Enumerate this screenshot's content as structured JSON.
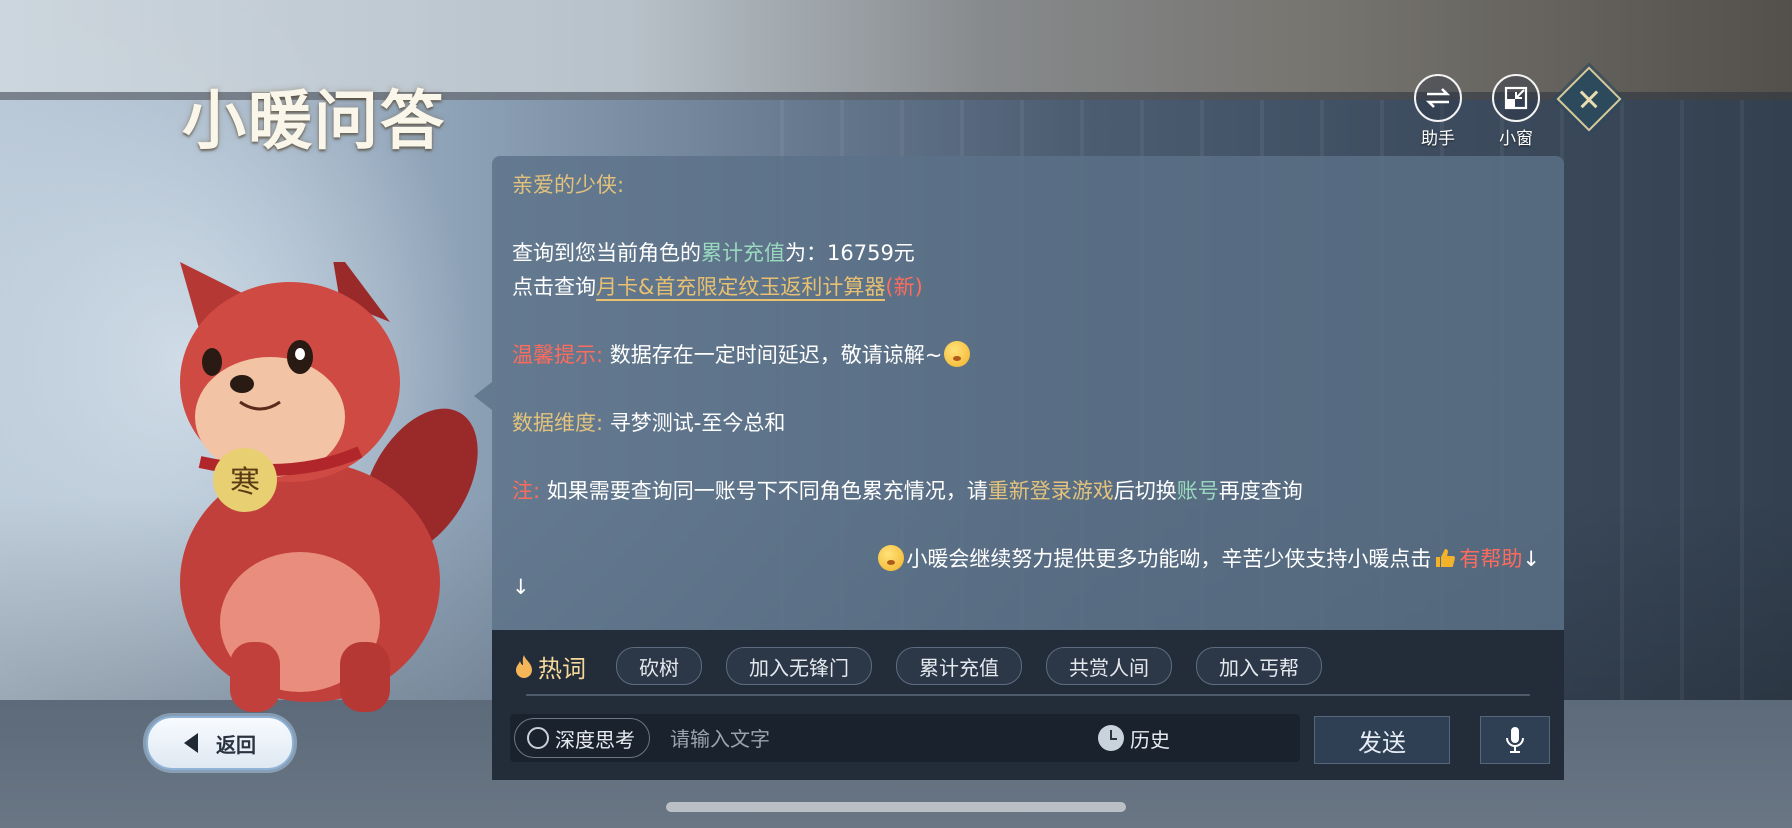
{
  "title": "小暖问答",
  "top_buttons": [
    {
      "label": "助手",
      "icon": "swap-arrows-icon"
    },
    {
      "label": "小窗",
      "icon": "minimize-window-icon"
    }
  ],
  "close_icon": "close-x-icon",
  "message": {
    "greeting": "亲爱的少侠:",
    "line1_prefix": "查询到您当前角色的",
    "line1_highlight": "累计充值",
    "line1_suffix": "为：16759元",
    "line2_prefix": "点击查询",
    "line2_link": "月卡&首充限定纹玉返利计算器",
    "line2_new": "(新)",
    "tip_label": "温馨提示:",
    "tip_text": " 数据存在一定时间延迟，敬请谅解~",
    "dim_label": "数据维度:",
    "dim_text": " 寻梦测试-至今总和",
    "note_label": "注:",
    "note_text1": " 如果需要查询同一账号下不同角色累充情况，请",
    "note_hl1": "重新登录游戏",
    "note_text2": "后切换",
    "note_hl2": "账号",
    "note_text3": "再度查询",
    "footer_text": "小暖会继续努力提供更多功能呦，辛苦少侠支持小暖点击",
    "footer_helpful": "有帮助",
    "footer_arrow": "↓",
    "trailing_arrow": "↓"
  },
  "hot": {
    "label": "热词",
    "chips": [
      "砍树",
      "加入无锋门",
      "累计充值",
      "共赏人间",
      "加入丐帮"
    ]
  },
  "input": {
    "deep_think": "深度思考",
    "placeholder": "请输入文字",
    "history": "历史",
    "send": "发送"
  },
  "back": "返回",
  "colors": {
    "gold": "#e2c27c",
    "teal": "#9ad8bf",
    "red": "#ff6b5c",
    "panel": "#5c7188"
  }
}
